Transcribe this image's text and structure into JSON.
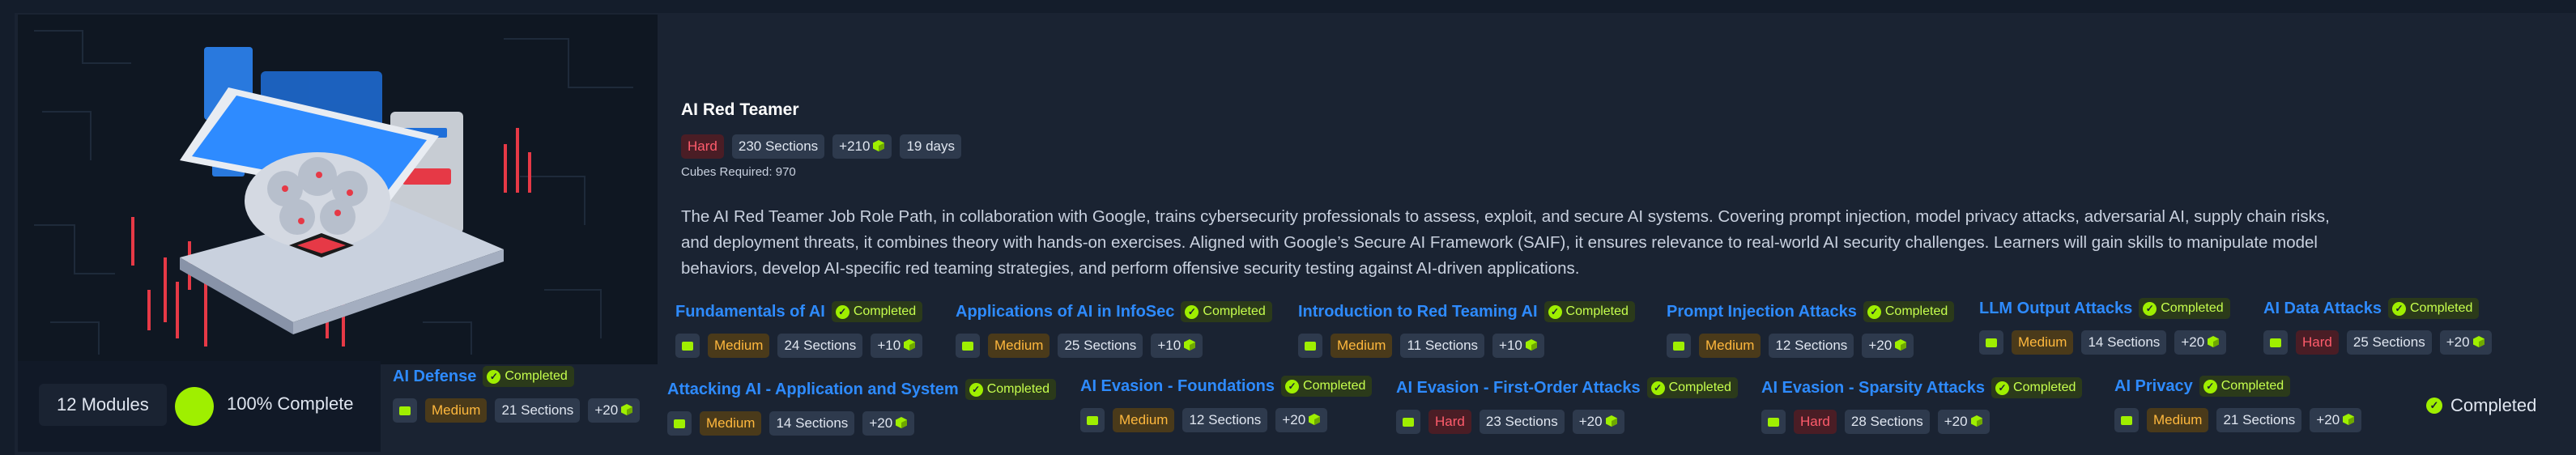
{
  "path": {
    "title": "AI Red Teamer",
    "difficulty": "Hard",
    "sections": "230 Sections",
    "cubes_reward": "+210",
    "duration": "19 days",
    "cubes_required": "Cubes Required: 970",
    "description": "The AI Red Teamer Job Role Path, in collaboration with Google, trains cybersecurity professionals to assess, exploit, and secure AI systems. Covering prompt injection, model privacy attacks, adversarial AI, supply chain risks, and deployment threats, it combines theory with hands-on exercises. Aligned with Google’s Secure AI Framework (SAIF), it ensures relevance to real-world AI security challenges. Learners will gain skills to manipulate model behaviors, develop AI-specific red teaming strategies, and perform offensive security testing against AI-driven applications."
  },
  "summary": {
    "modules_label": "12 Modules",
    "progress_label": "100% Complete",
    "progress_value": 1.0,
    "final_status": "Completed"
  },
  "colors": {
    "accent": "#9fef00",
    "link": "#2e8bff",
    "hard": "#ff5c6c",
    "medium": "#ffb83d",
    "background": "#1a2332"
  },
  "modules": [
    {
      "name": "Fundamentals of AI",
      "status": "Completed",
      "difficulty": "Medium",
      "sections": "24 Sections",
      "reward": "+10"
    },
    {
      "name": "Applications of AI in InfoSec",
      "status": "Completed",
      "difficulty": "Medium",
      "sections": "25 Sections",
      "reward": "+10"
    },
    {
      "name": "Introduction to Red Teaming AI",
      "status": "Completed",
      "difficulty": "Medium",
      "sections": "11 Sections",
      "reward": "+10"
    },
    {
      "name": "Prompt Injection Attacks",
      "status": "Completed",
      "difficulty": "Medium",
      "sections": "12 Sections",
      "reward": "+20"
    },
    {
      "name": "LLM Output Attacks",
      "status": "Completed",
      "difficulty": "Medium",
      "sections": "14 Sections",
      "reward": "+20"
    },
    {
      "name": "AI Data Attacks",
      "status": "Completed",
      "difficulty": "Hard",
      "sections": "25 Sections",
      "reward": "+20"
    },
    {
      "name": "AI Defense",
      "status": "Completed",
      "difficulty": "Medium",
      "sections": "21 Sections",
      "reward": "+20"
    },
    {
      "name": "Attacking AI - Application and System",
      "status": "Completed",
      "difficulty": "Medium",
      "sections": "14 Sections",
      "reward": "+20"
    },
    {
      "name": "AI Evasion - Foundations",
      "status": "Completed",
      "difficulty": "Medium",
      "sections": "12 Sections",
      "reward": "+20"
    },
    {
      "name": "AI Evasion - First-Order Attacks",
      "status": "Completed",
      "difficulty": "Hard",
      "sections": "23 Sections",
      "reward": "+20"
    },
    {
      "name": "AI Evasion - Sparsity Attacks",
      "status": "Completed",
      "difficulty": "Hard",
      "sections": "28 Sections",
      "reward": "+20"
    },
    {
      "name": "AI Privacy",
      "status": "Completed",
      "difficulty": "Medium",
      "sections": "21 Sections",
      "reward": "+20"
    }
  ]
}
